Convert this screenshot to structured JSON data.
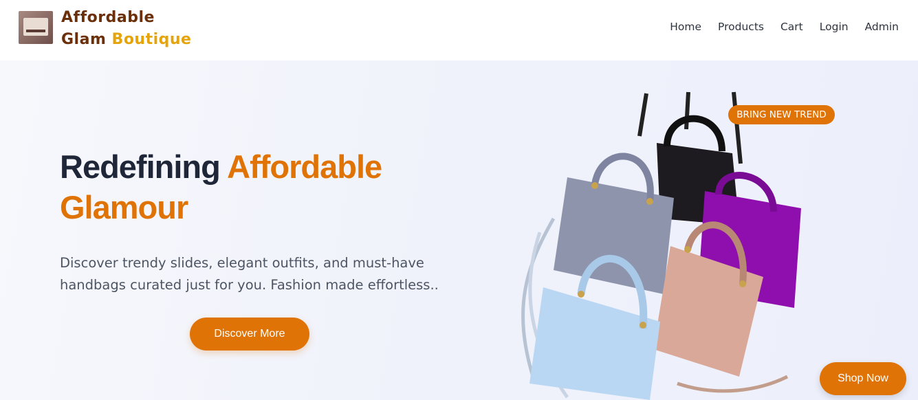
{
  "header": {
    "brand_line1": "Affordable",
    "brand_line2_a": "Glam",
    "brand_line2_b": "Boutique",
    "nav": [
      "Home",
      "Products",
      "Cart",
      "Login",
      "Admin"
    ]
  },
  "hero": {
    "headline_a": "Redefining",
    "headline_b": "Affordable",
    "headline_c": "Glamour",
    "description": "Discover trendy slides, elegant outfits, and must-have handbags curated just for you. Fashion made effortless..",
    "cta_label": "Discover More",
    "badge": "BRING NEW TREND",
    "shop_label": "Shop Now"
  },
  "colors": {
    "accent": "#e07306",
    "brand_dark": "#6b2f0a",
    "brand_gold": "#e6a40b",
    "text_dark": "#1e2638"
  }
}
